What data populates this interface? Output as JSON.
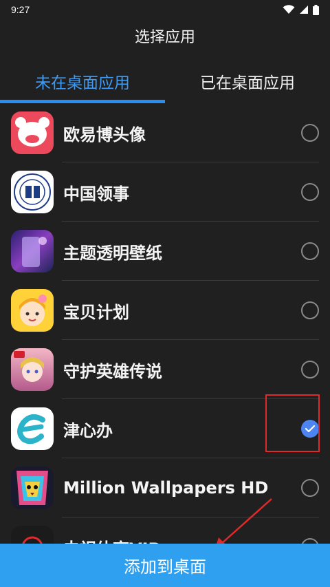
{
  "status_bar": {
    "time": "9:27"
  },
  "header": {
    "title": "选择应用"
  },
  "tabs": [
    {
      "label": "未在桌面应用",
      "selected": true
    },
    {
      "label": "已在桌面应用",
      "selected": false
    }
  ],
  "apps": [
    {
      "name": "欧易博头像",
      "checked": false
    },
    {
      "name": "中国领事",
      "checked": false
    },
    {
      "name": "主题透明壁纸",
      "checked": false
    },
    {
      "name": "宝贝计划",
      "checked": false
    },
    {
      "name": "守护英雄传说",
      "checked": false
    },
    {
      "name": "津心办",
      "checked": true
    },
    {
      "name": "Million Wallpapers HD",
      "checked": false
    },
    {
      "name": "虫视体育VIP",
      "checked": false
    }
  ],
  "actions": {
    "add_to_desktop": "添加到桌面"
  },
  "colors": {
    "accent": "#2a8ef0",
    "button": "#2f9ff0",
    "checked": "#4c84f0",
    "annotation": "#e02a2a"
  }
}
